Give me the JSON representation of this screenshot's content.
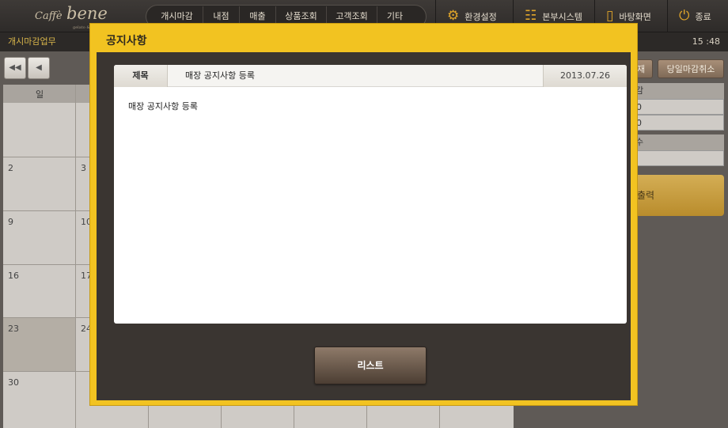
{
  "app": {
    "logo": {
      "caffe": "Caffè",
      "bene": "bene",
      "tagline": "gelato & waffle"
    }
  },
  "menu": {
    "items": [
      {
        "label": "개시마감"
      },
      {
        "label": "내점"
      },
      {
        "label": "매출"
      },
      {
        "label": "상품조회"
      },
      {
        "label": "고객조회"
      },
      {
        "label": "기타"
      }
    ]
  },
  "system_buttons": [
    {
      "label": "환경설정",
      "icon": "gear-icon"
    },
    {
      "label": "본부시스템",
      "icon": "sliders-icon"
    },
    {
      "label": "바탕화면",
      "icon": "tablet-icon"
    },
    {
      "label": "종료",
      "icon": "power-icon"
    }
  ],
  "subbar": {
    "section": "개시마감업무",
    "time": "15 :48"
  },
  "calendar": {
    "header_visible": [
      "일"
    ],
    "day_numbers": [
      "2",
      "3",
      "9",
      "10",
      "16",
      "17",
      "23",
      "24",
      "30"
    ]
  },
  "right_panel": {
    "btn_partial": "재",
    "cancel_close": "당일마감취소",
    "box1_head": "감",
    "box1_rows": [
      "0",
      "0"
    ],
    "box2_head": "수",
    "print_label": "출력"
  },
  "modal": {
    "title": "공지사항",
    "subject_label": "제목",
    "subject": "매장 공지사항 등록",
    "date": "2013.07.26",
    "body": "매장 공지사항 등록",
    "list_button": "리스트"
  },
  "colors": {
    "accent": "#f2c321",
    "panel": "#3a3531",
    "button": "#6d5a4b"
  }
}
